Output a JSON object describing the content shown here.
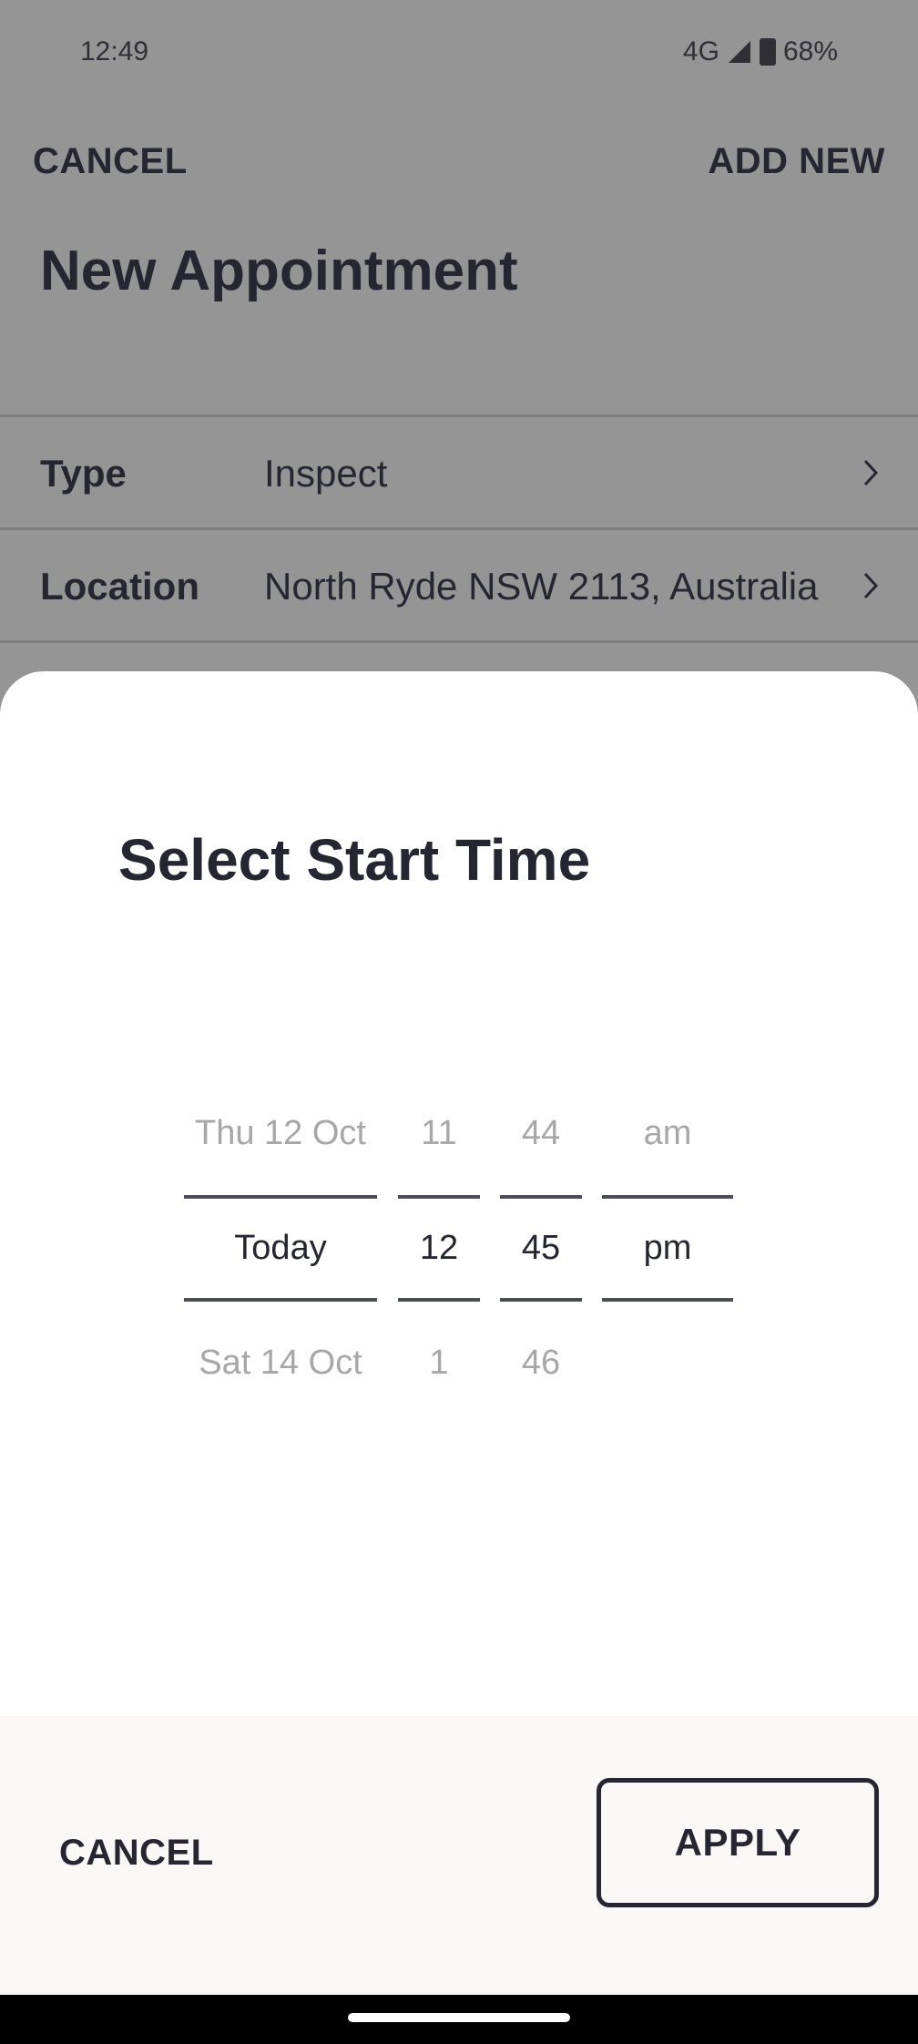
{
  "status_bar": {
    "time": "12:49",
    "network": "4G",
    "battery": "68%"
  },
  "top_bar": {
    "cancel_label": "CANCEL",
    "add_new_label": "ADD NEW"
  },
  "page": {
    "title": "New Appointment"
  },
  "form": {
    "rows": [
      {
        "label": "Type",
        "value": "Inspect"
      },
      {
        "label": "Location",
        "value": "North Ryde NSW 2113, Australia"
      }
    ]
  },
  "sheet": {
    "title": "Select Start Time",
    "picker": {
      "date": {
        "prev": "Thu 12 Oct",
        "selected": "Today",
        "next": "Sat 14 Oct"
      },
      "hour": {
        "prev": "11",
        "selected": "12",
        "next": "1"
      },
      "minute": {
        "prev": "44",
        "selected": "45",
        "next": "46"
      },
      "ampm": {
        "prev": "am",
        "selected": "pm",
        "next": ""
      }
    },
    "cancel_label": "CANCEL",
    "apply_label": "APPLY"
  },
  "colors": {
    "overlay_bg": "#959595",
    "text_dark": "#262633",
    "text_dim": "#a7a7a7",
    "footer_bg": "#f9f8f6"
  }
}
